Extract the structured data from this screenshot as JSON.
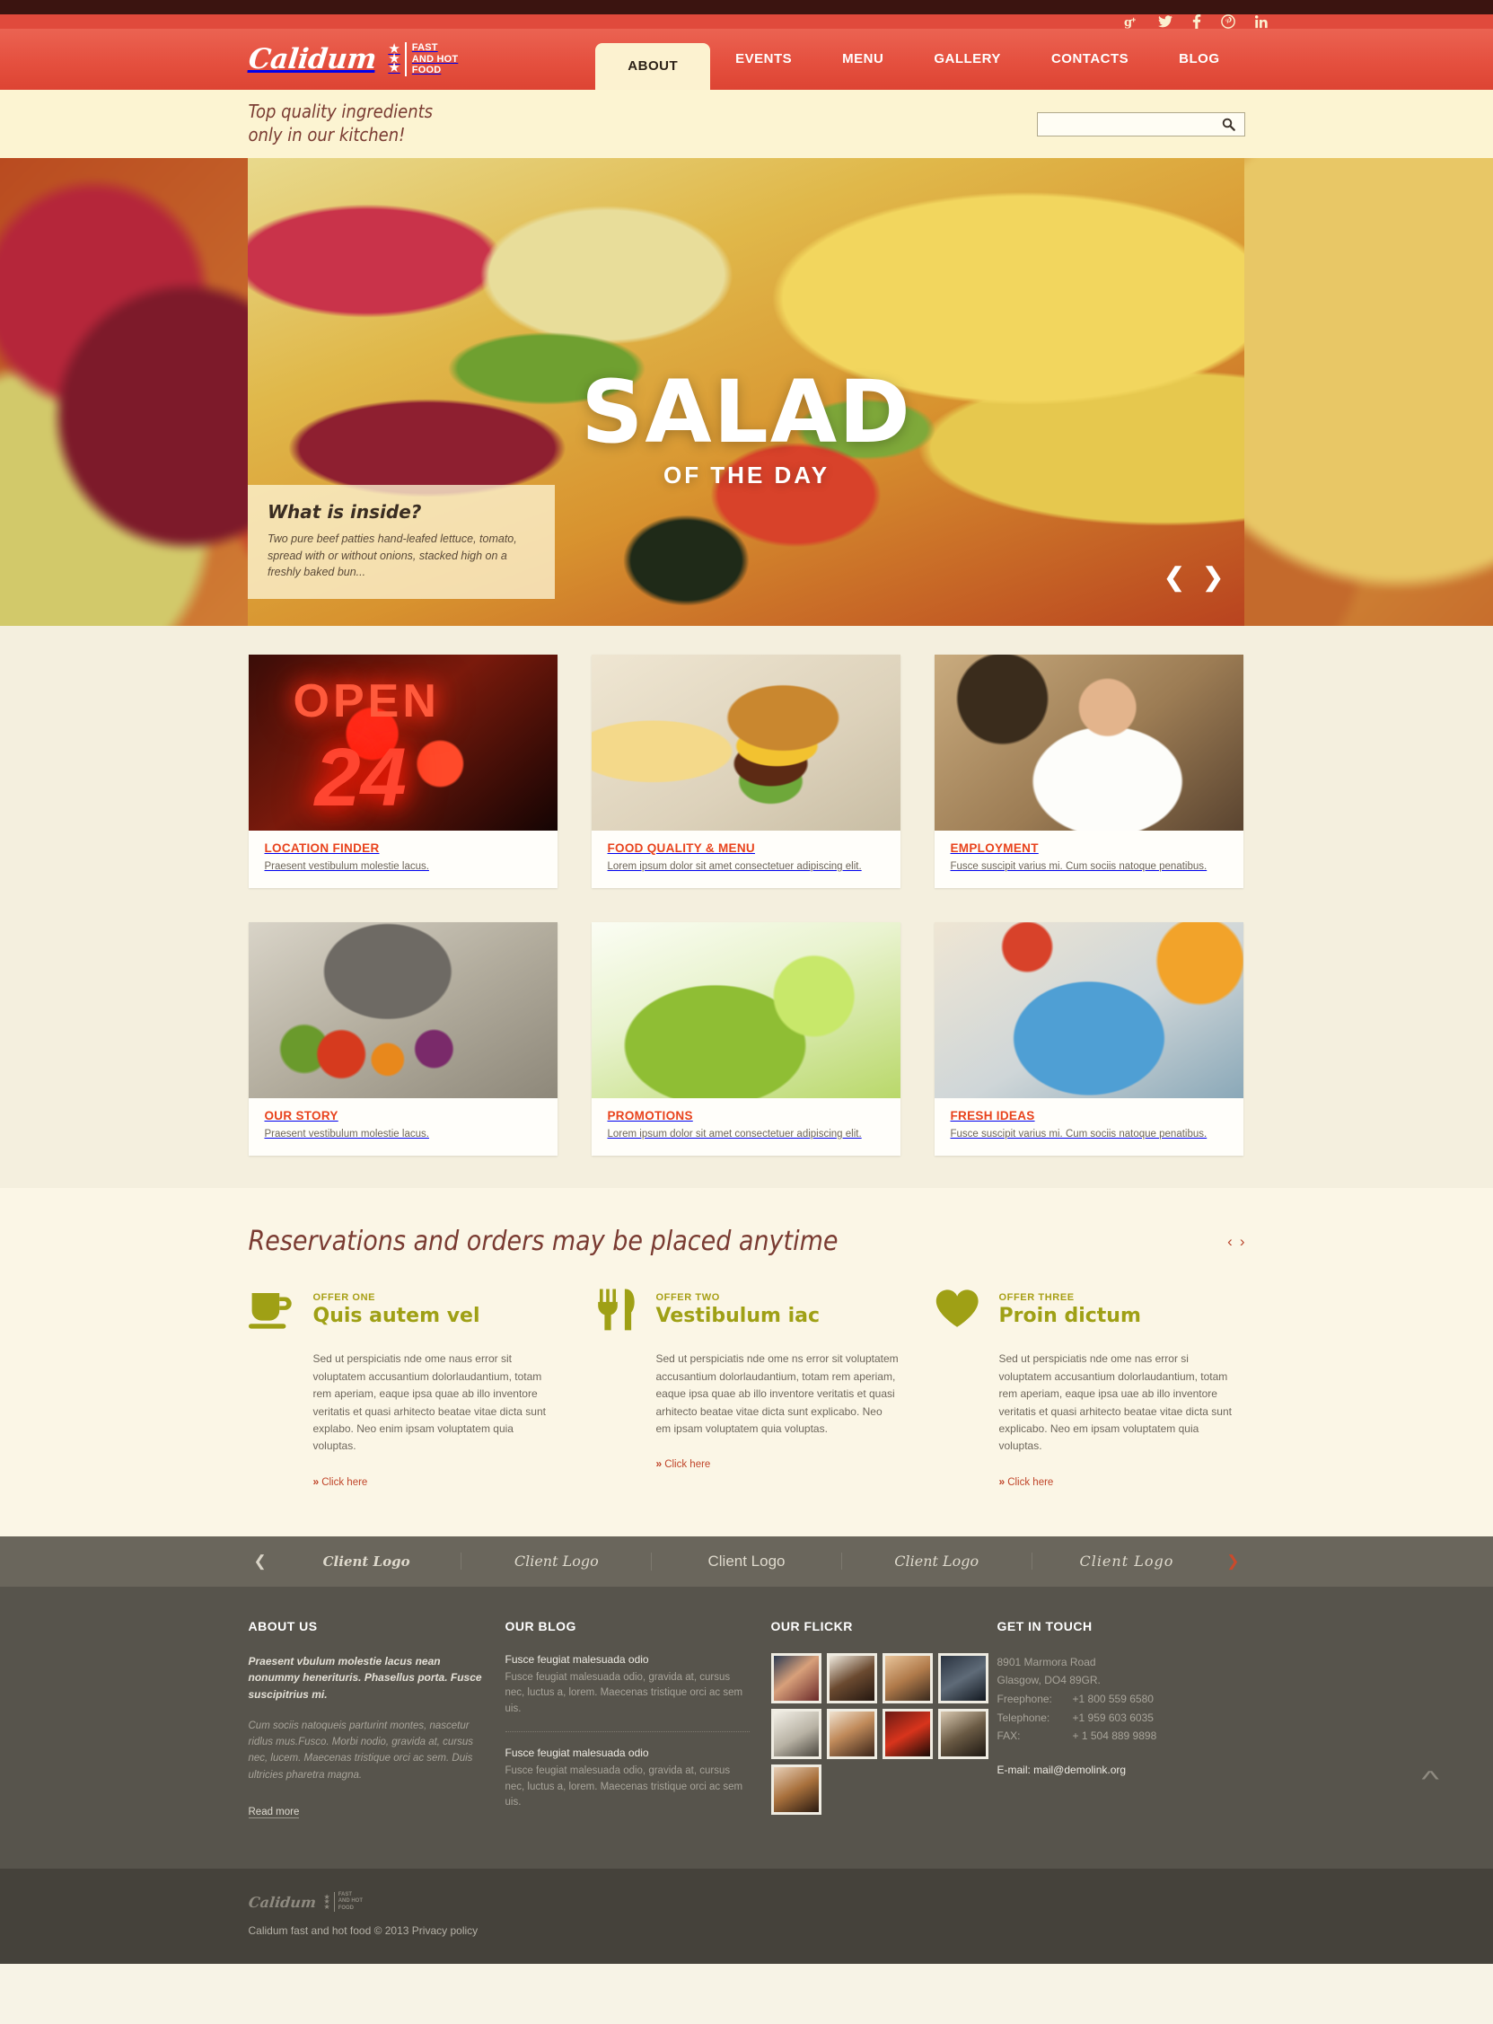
{
  "topbar": {
    "social": [
      {
        "name": "google-plus-icon",
        "label": "g+"
      },
      {
        "name": "twitter-icon",
        "label": "t"
      },
      {
        "name": "facebook-icon",
        "label": "f"
      },
      {
        "name": "pinterest-icon",
        "label": "p"
      },
      {
        "name": "linkedin-icon",
        "label": "in"
      }
    ]
  },
  "brand": {
    "name": "Calidum",
    "tagline_line1": "FAST",
    "tagline_line2": "AND HOT",
    "tagline_line3": "FOOD",
    "stars": "★★★",
    "accent_red": "#e0493a",
    "accent_cream": "#fcf2d0",
    "accent_olive": "#9fa015",
    "accent_orange": "#e8421c"
  },
  "nav": {
    "items": [
      {
        "label": "ABOUT",
        "active": true
      },
      {
        "label": "EVENTS",
        "active": false
      },
      {
        "label": "MENU",
        "active": false
      },
      {
        "label": "GALLERY",
        "active": false
      },
      {
        "label": "CONTACTS",
        "active": false
      },
      {
        "label": "BLOG",
        "active": false
      }
    ]
  },
  "tagbar": {
    "line1": "Top quality ingredients",
    "line2": "only in our kitchen!",
    "search_value": "",
    "search_placeholder": ""
  },
  "slider": {
    "title": "SALAD",
    "subtitle": "OF THE DAY",
    "caption_title": "What is inside?",
    "caption_text": "Two pure beef patties hand-leafed lettuce, tomato, spread with or without onions, stacked high on a freshly baked bun...",
    "prev": "❮",
    "next": "❯"
  },
  "cards": [
    {
      "title": "LOCATION FINDER",
      "desc": "Praesent vestibulum molestie lacus.",
      "img": "img-open"
    },
    {
      "title": "FOOD QUALITY & MENU",
      "desc": "Lorem ipsum dolor sit amet consectetuer adipiscing elit.",
      "img": "img-burger"
    },
    {
      "title": "EMPLOYMENT",
      "desc": "Fusce suscipit varius mi. Cum sociis natoque penatibus.",
      "img": "img-chef"
    },
    {
      "title": "OUR STORY",
      "desc": "Praesent vestibulum molestie lacus.",
      "img": "img-story"
    },
    {
      "title": "PROMOTIONS",
      "desc": "Lorem ipsum dolor sit amet consectetuer adipiscing elit.",
      "img": "img-drink"
    },
    {
      "title": "FRESH IDEAS",
      "desc": "Fusce suscipit varius mi. Cum sociis natoque penatibus.",
      "img": "img-fresh"
    }
  ],
  "offers": {
    "heading": "Reservations and orders may be placed anytime",
    "prev": "‹",
    "next": "›",
    "items": [
      {
        "label": "OFFER ONE",
        "title": "Quis autem vel",
        "text": "Sed ut perspiciatis nde ome naus error sit voluptatem accusantium dolorlaudantium, totam rem aperiam, eaque ipsa quae ab illo inventore veritatis et quasi arhitecto beatae vitae dicta sunt explabo. Neo enim ipsam voluptatem quia voluptas.",
        "link": "Click here",
        "icon": "cup-icon"
      },
      {
        "label": "OFFER TWO",
        "title": "Vestibulum iac",
        "text": "Sed ut perspiciatis nde ome ns error sit voluptatem accusantium dolorlaudantium, totam rem aperiam, eaque ipsa quae ab illo inventore veritatis et quasi arhitecto beatae vitae dicta sunt explicabo. Neo em ipsam voluptatem quia voluptas.",
        "link": "Click here",
        "icon": "fork-knife-icon"
      },
      {
        "label": "OFFER THREE",
        "title": "Proin dictum",
        "text": "Sed ut perspiciatis nde ome nas error si voluptatem accusantium dolorlaudantium, totam rem aperiam, eaque ipsa uae ab illo inventore veritatis et quasi arhitecto beatae vitae dicta sunt explicabo. Neo em ipsam voluptatem quia voluptas.",
        "link": "Click here",
        "icon": "heart-icon"
      }
    ]
  },
  "clients": {
    "prev": "❮",
    "next": "❯",
    "items": [
      {
        "label": "Client Logo",
        "style": "cl-1"
      },
      {
        "label": "Client Logo",
        "style": "cl-2"
      },
      {
        "label": "Client Logo",
        "style": "cl-3"
      },
      {
        "label": "Client Logo",
        "style": "cl-4"
      },
      {
        "label": "Client Logo",
        "style": "cl-5"
      }
    ]
  },
  "footer": {
    "about": {
      "heading": "ABOUT US",
      "lead": "Praesent vbulum molestie lacus nean nonummy henerituris. Phasellus porta. Fusce suscipitrius mi.",
      "body": "Cum sociis natoqueis parturint montes, nascetur ridlus mus.Fusco. Morbi nodio, gravida at, cursus nec, lucem. Maecenas tristique orci ac sem. Duis ultricies pharetra magna.",
      "read_more": "Read more"
    },
    "blog": {
      "heading": "OUR BLOG",
      "posts": [
        {
          "title": "Fusce feugiat malesuada odio",
          "text": "Fusce feugiat malesuada odio, gravida at, cursus nec, luctus a, lorem. Maecenas tristique orci ac sem uis."
        },
        {
          "title": "Fusce feugiat malesuada odio",
          "text": "Fusce feugiat malesuada odio, gravida at, cursus nec, luctus a, lorem. Maecenas tristique orci ac sem uis."
        }
      ]
    },
    "flickr": {
      "heading": "OUR FLICKR",
      "thumbs": [
        "fl1",
        "fl2",
        "fl3",
        "fl4",
        "fl5",
        "fl6",
        "fl7",
        "fl8",
        "fl9"
      ]
    },
    "touch": {
      "heading": "GET IN TOUCH",
      "address1": "8901 Marmora Road",
      "address2": "Glasgow, DO4 89GR.",
      "freephone_label": "Freephone:",
      "freephone_value": "+1 800 559 6580",
      "telephone_label": "Telephone:",
      "telephone_value": "+1 959 603 6035",
      "fax_label": "FAX:",
      "fax_value": "+ 1 504 889 9898",
      "email": "E-mail: mail@demolink.org"
    }
  },
  "copyright": {
    "name": "Calidum",
    "tag1": "FAST",
    "tag2": "AND HOT",
    "tag3": "FOOD",
    "text": "Calidum fast and hot food © 2013 Privacy policy"
  }
}
